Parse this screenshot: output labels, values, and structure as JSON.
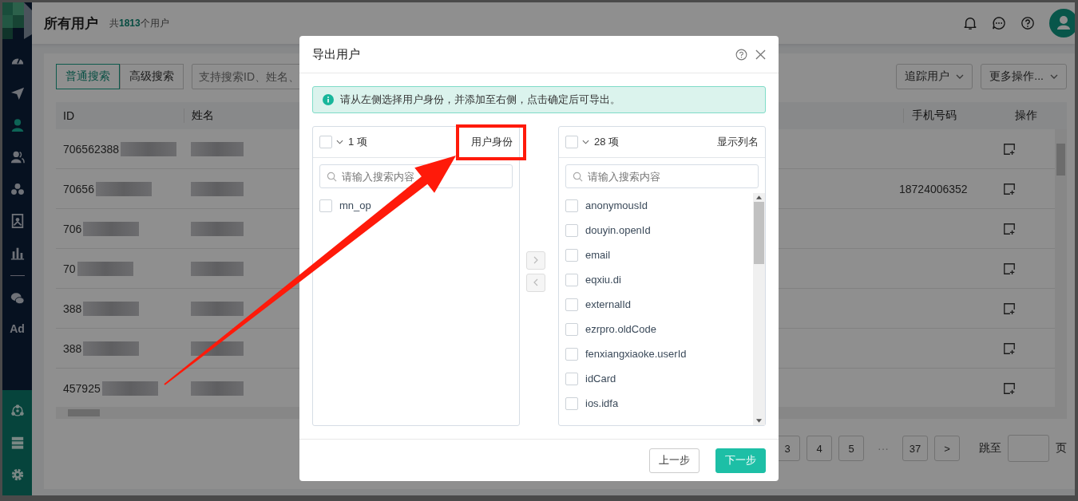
{
  "header": {
    "title": "所有用户",
    "subtitle": "共**1813**个用户"
  },
  "sidebar": {
    "items": [
      {
        "selected": false
      },
      {
        "selected": false
      },
      {
        "selected": true
      },
      {
        "selected": false
      },
      {
        "selected": false
      },
      {
        "selected": false
      },
      {
        "selected": false
      },
      {
        "selected": false
      },
      {
        "label": "Ad",
        "selected": false
      }
    ]
  },
  "toolbar": {
    "search_modes": [
      {
        "label": "普通搜索",
        "selected": true
      },
      {
        "label": "高级搜索",
        "selected": false
      }
    ],
    "search": {
      "placeholder": "支持搜索ID、姓名、"
    },
    "dropdowns": [
      "追踪用户",
      "更多操作..."
    ]
  },
  "table": {
    "columns": [
      "ID",
      "姓名",
      "手机号码",
      "操作"
    ],
    "rows": [
      {
        "id": "706562388",
        "phone": ""
      },
      {
        "id": "70656",
        "phone": "18724006352"
      },
      {
        "id": "706",
        "phone": ""
      },
      {
        "id": "70",
        "phone": ""
      },
      {
        "id": "388",
        "phone": ""
      },
      {
        "id": "388",
        "phone": ""
      },
      {
        "id": "457925",
        "phone": ""
      }
    ]
  },
  "pagination": {
    "pages": [
      {
        "label": "3",
        "selected": false
      },
      {
        "label": "4",
        "selected": false
      },
      {
        "label": "5",
        "selected": false
      },
      {
        "label": "···",
        "kind": "ellipsis",
        "selected": false
      },
      {
        "label": "37",
        "selected": false
      }
    ],
    "next": ">",
    "jump_label": "跳至",
    "page_unit": "页"
  },
  "dialog": {
    "title": "导出用户",
    "alert": "请从左侧选择用户身份，并添加至右侧，点击确定后可导出。",
    "source": {
      "checked": false,
      "count": "1 项",
      "title": "用户身份",
      "placeholder": "请输入搜索内容",
      "items": [
        {
          "label": "mn_op",
          "checked": false
        }
      ]
    },
    "target": {
      "checked": false,
      "count": "28 项",
      "title": "显示列名",
      "placeholder": "请输入搜索内容",
      "items": [
        {
          "label": "anonymousId",
          "checked": false
        },
        {
          "label": "douyin.openId",
          "checked": false
        },
        {
          "label": "email",
          "checked": false
        },
        {
          "label": "eqxiu.di",
          "checked": false
        },
        {
          "label": "externalId",
          "checked": false
        },
        {
          "label": "ezrpro.oldCode",
          "checked": false
        },
        {
          "label": "fenxiangxiaoke.userId",
          "checked": false
        },
        {
          "label": "idCard",
          "checked": false
        },
        {
          "label": "ios.idfa",
          "checked": false
        }
      ]
    },
    "buttons": [
      {
        "label": "上一步",
        "kind": "default"
      },
      {
        "label": "下一步",
        "kind": "primary"
      }
    ]
  }
}
